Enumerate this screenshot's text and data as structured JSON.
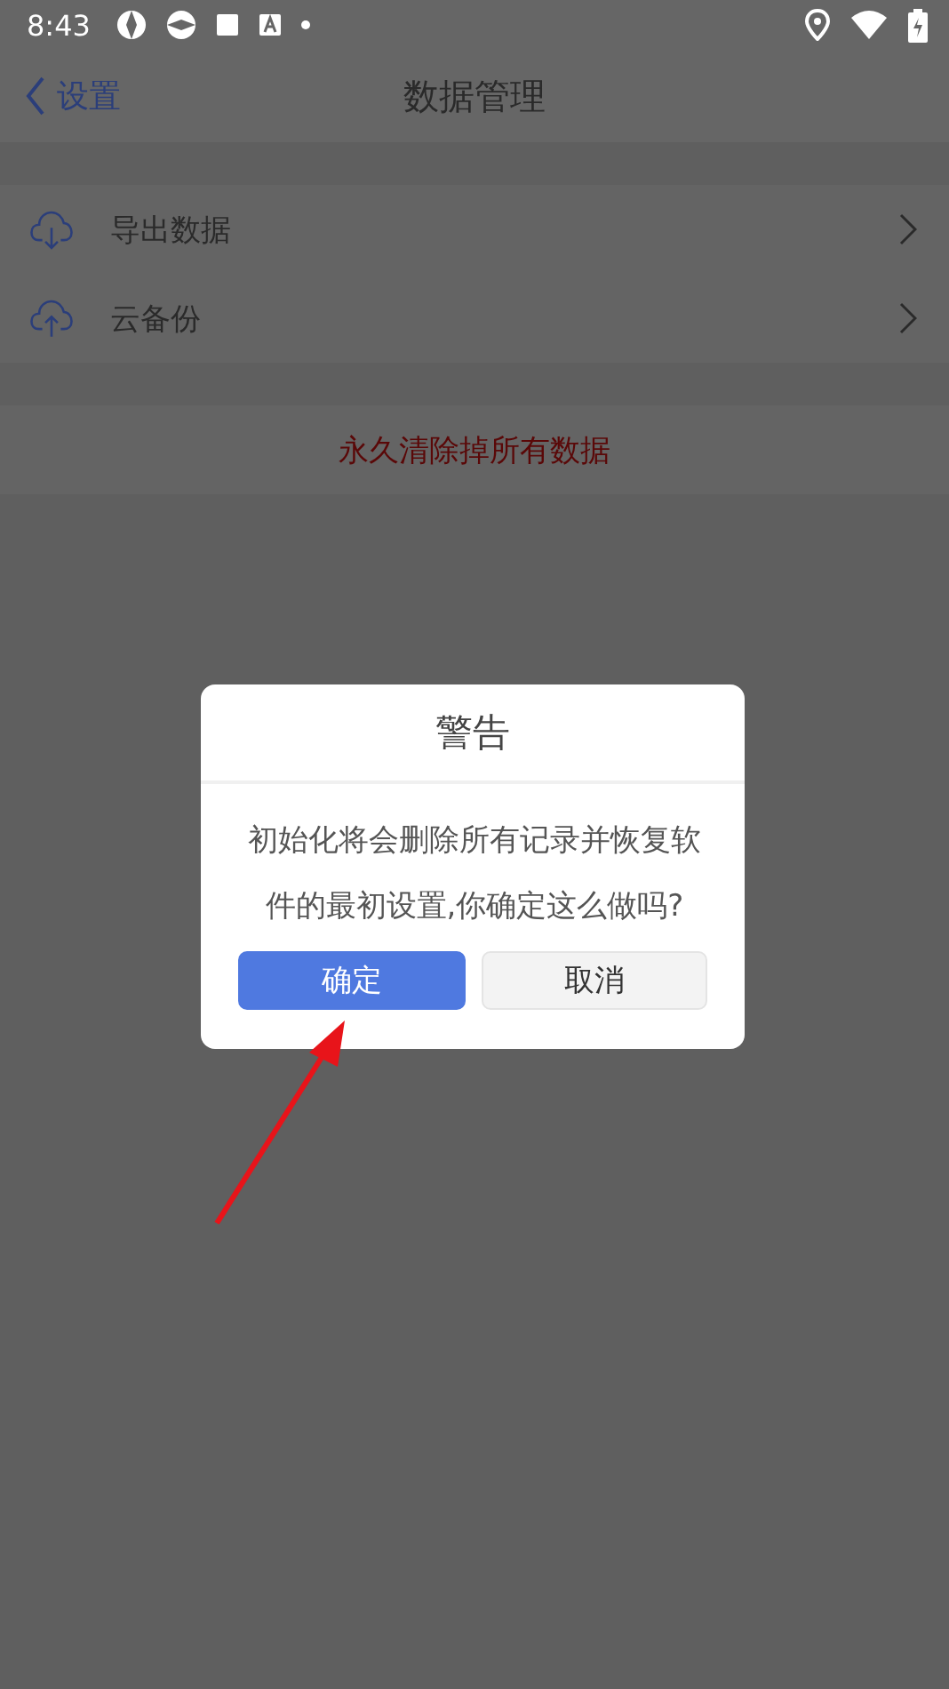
{
  "status_bar": {
    "time": "8:43"
  },
  "nav": {
    "back_label": "设置",
    "title": "数据管理"
  },
  "menu": [
    {
      "kind": "download",
      "label": "导出数据"
    },
    {
      "kind": "upload",
      "label": "云备份"
    }
  ],
  "danger_action": {
    "label": "永久清除掉所有数据"
  },
  "dialog": {
    "title": "警告",
    "message": "初始化将会删除所有记录并恢复软件的最初设置,你确定这么做吗?",
    "buttons": [
      {
        "label": "确定",
        "kind": "primary"
      },
      {
        "label": "取消",
        "kind": "secondary"
      }
    ]
  }
}
